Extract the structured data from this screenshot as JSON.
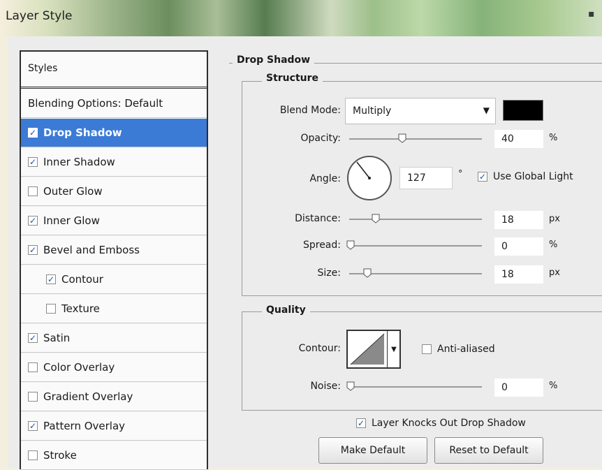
{
  "window": {
    "title": "Layer Style"
  },
  "styles_panel": {
    "header": "Styles",
    "blending_options": "Blending Options: Default",
    "items": [
      {
        "label": "Drop Shadow",
        "checked": true,
        "selected": true,
        "indent": false
      },
      {
        "label": "Inner Shadow",
        "checked": true,
        "selected": false,
        "indent": false
      },
      {
        "label": "Outer Glow",
        "checked": false,
        "selected": false,
        "indent": false
      },
      {
        "label": "Inner Glow",
        "checked": true,
        "selected": false,
        "indent": false
      },
      {
        "label": "Bevel and Emboss",
        "checked": true,
        "selected": false,
        "indent": false
      },
      {
        "label": "Contour",
        "checked": true,
        "selected": false,
        "indent": true
      },
      {
        "label": "Texture",
        "checked": false,
        "selected": false,
        "indent": true
      },
      {
        "label": "Satin",
        "checked": true,
        "selected": false,
        "indent": false
      },
      {
        "label": "Color Overlay",
        "checked": false,
        "selected": false,
        "indent": false
      },
      {
        "label": "Gradient Overlay",
        "checked": false,
        "selected": false,
        "indent": false
      },
      {
        "label": "Pattern Overlay",
        "checked": true,
        "selected": false,
        "indent": false
      },
      {
        "label": "Stroke",
        "checked": false,
        "selected": false,
        "indent": false
      }
    ]
  },
  "drop_shadow": {
    "title": "Drop Shadow",
    "structure": {
      "title": "Structure",
      "blend_mode_label": "Blend Mode:",
      "blend_mode_value": "Multiply",
      "shadow_color": "#000000",
      "opacity_label": "Opacity:",
      "opacity_value": "40",
      "opacity_unit": "%",
      "angle_label": "Angle:",
      "angle_value": "127",
      "angle_unit": "°",
      "use_global_light_label": "Use Global Light",
      "use_global_light_checked": true,
      "distance_label": "Distance:",
      "distance_value": "18",
      "distance_unit": "px",
      "spread_label": "Spread:",
      "spread_value": "0",
      "spread_unit": "%",
      "size_label": "Size:",
      "size_value": "18",
      "size_unit": "px"
    },
    "quality": {
      "title": "Quality",
      "contour_label": "Contour:",
      "anti_aliased_label": "Anti-aliased",
      "anti_aliased_checked": false,
      "noise_label": "Noise:",
      "noise_value": "0",
      "noise_unit": "%"
    },
    "knockout_label": "Layer Knocks Out Drop Shadow",
    "knockout_checked": true,
    "make_default_label": "Make Default",
    "reset_default_label": "Reset to Default"
  }
}
